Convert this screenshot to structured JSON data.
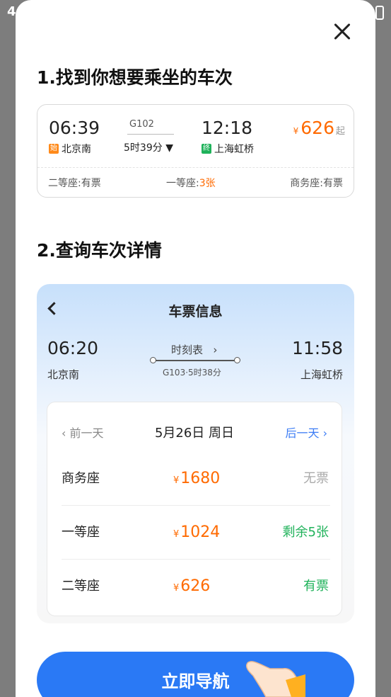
{
  "status": {
    "left_text": "4"
  },
  "steps": {
    "step1_title": "1.找到你想要乘坐的车次",
    "step2_title": "2.查询车次详情"
  },
  "train_card": {
    "depart_time": "06:39",
    "depart_badge": "始",
    "depart_station": "北京南",
    "train_no": "G102",
    "duration": "5时39分",
    "arrive_time": "12:18",
    "arrive_badge": "终",
    "arrive_station": "上海虹桥",
    "price_symbol": "¥",
    "price": "626",
    "price_suffix": "起",
    "seats": [
      {
        "label": "二等座:",
        "status": "有票"
      },
      {
        "label": "一等座:",
        "status": "3张"
      },
      {
        "label": "商务座:",
        "status": "有票"
      }
    ]
  },
  "detail_card": {
    "title": "车票信息",
    "depart_time": "06:20",
    "depart_station": "北京南",
    "schedule_link": "时刻表",
    "train_info": "G103·5时38分",
    "arrive_time": "11:58",
    "arrive_station": "上海虹桥",
    "prev_day": "前一天",
    "date": "5月26日  周日",
    "next_day": "后一天",
    "seat_rows": [
      {
        "name": "商务座",
        "price_symbol": "¥",
        "price": "1680",
        "status": "无票"
      },
      {
        "name": "一等座",
        "price_symbol": "¥",
        "price": "1024",
        "status": "剩余5张"
      },
      {
        "name": "二等座",
        "price_symbol": "¥",
        "price": "626",
        "status": "有票"
      }
    ]
  },
  "button": {
    "label": "立即导航"
  },
  "colors": {
    "accent": "#2a79f5",
    "price": "#ff6a00",
    "available": "#1fb25a",
    "unavailable": "#aaaaaa"
  }
}
